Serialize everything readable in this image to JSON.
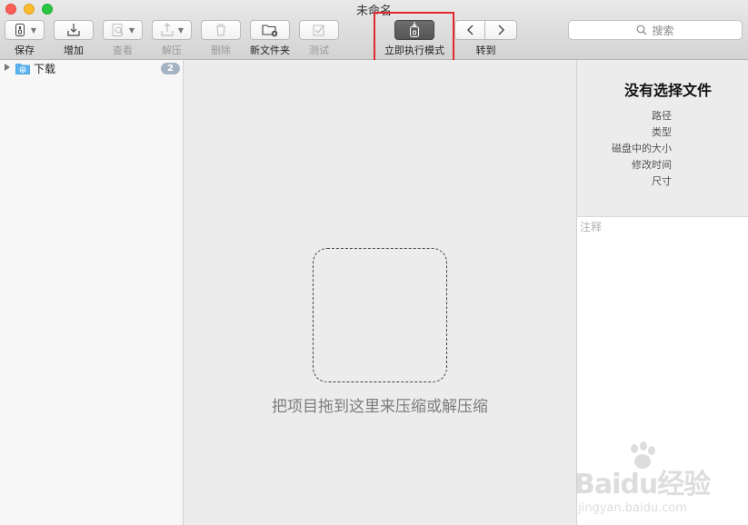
{
  "window": {
    "title": "未命名"
  },
  "toolbar": {
    "save_label": "保存",
    "add_label": "增加",
    "view_label": "查看",
    "extract_label": "解压",
    "delete_label": "删除",
    "new_folder_label": "新文件夹",
    "test_label": "测试",
    "instant_mode_label": "立即执行模式",
    "goto_label": "转到"
  },
  "search": {
    "placeholder": "搜索"
  },
  "sidebar": {
    "items": [
      {
        "label": "下载",
        "badge": "2"
      }
    ]
  },
  "main": {
    "drop_hint": "把项目拖到这里来压缩或解压缩"
  },
  "info_panel": {
    "title": "没有选择文件",
    "fields": [
      "路径",
      "类型",
      "磁盘中的大小",
      "修改时间",
      "尺寸"
    ]
  },
  "notes": {
    "placeholder": "注释"
  },
  "watermark": {
    "brand": "Baidu经验",
    "url": "jingyan.baidu.com"
  },
  "colors": {
    "highlight": "#e1282e",
    "badge": "#a6b3c4",
    "folder": "#5bb5ee"
  }
}
